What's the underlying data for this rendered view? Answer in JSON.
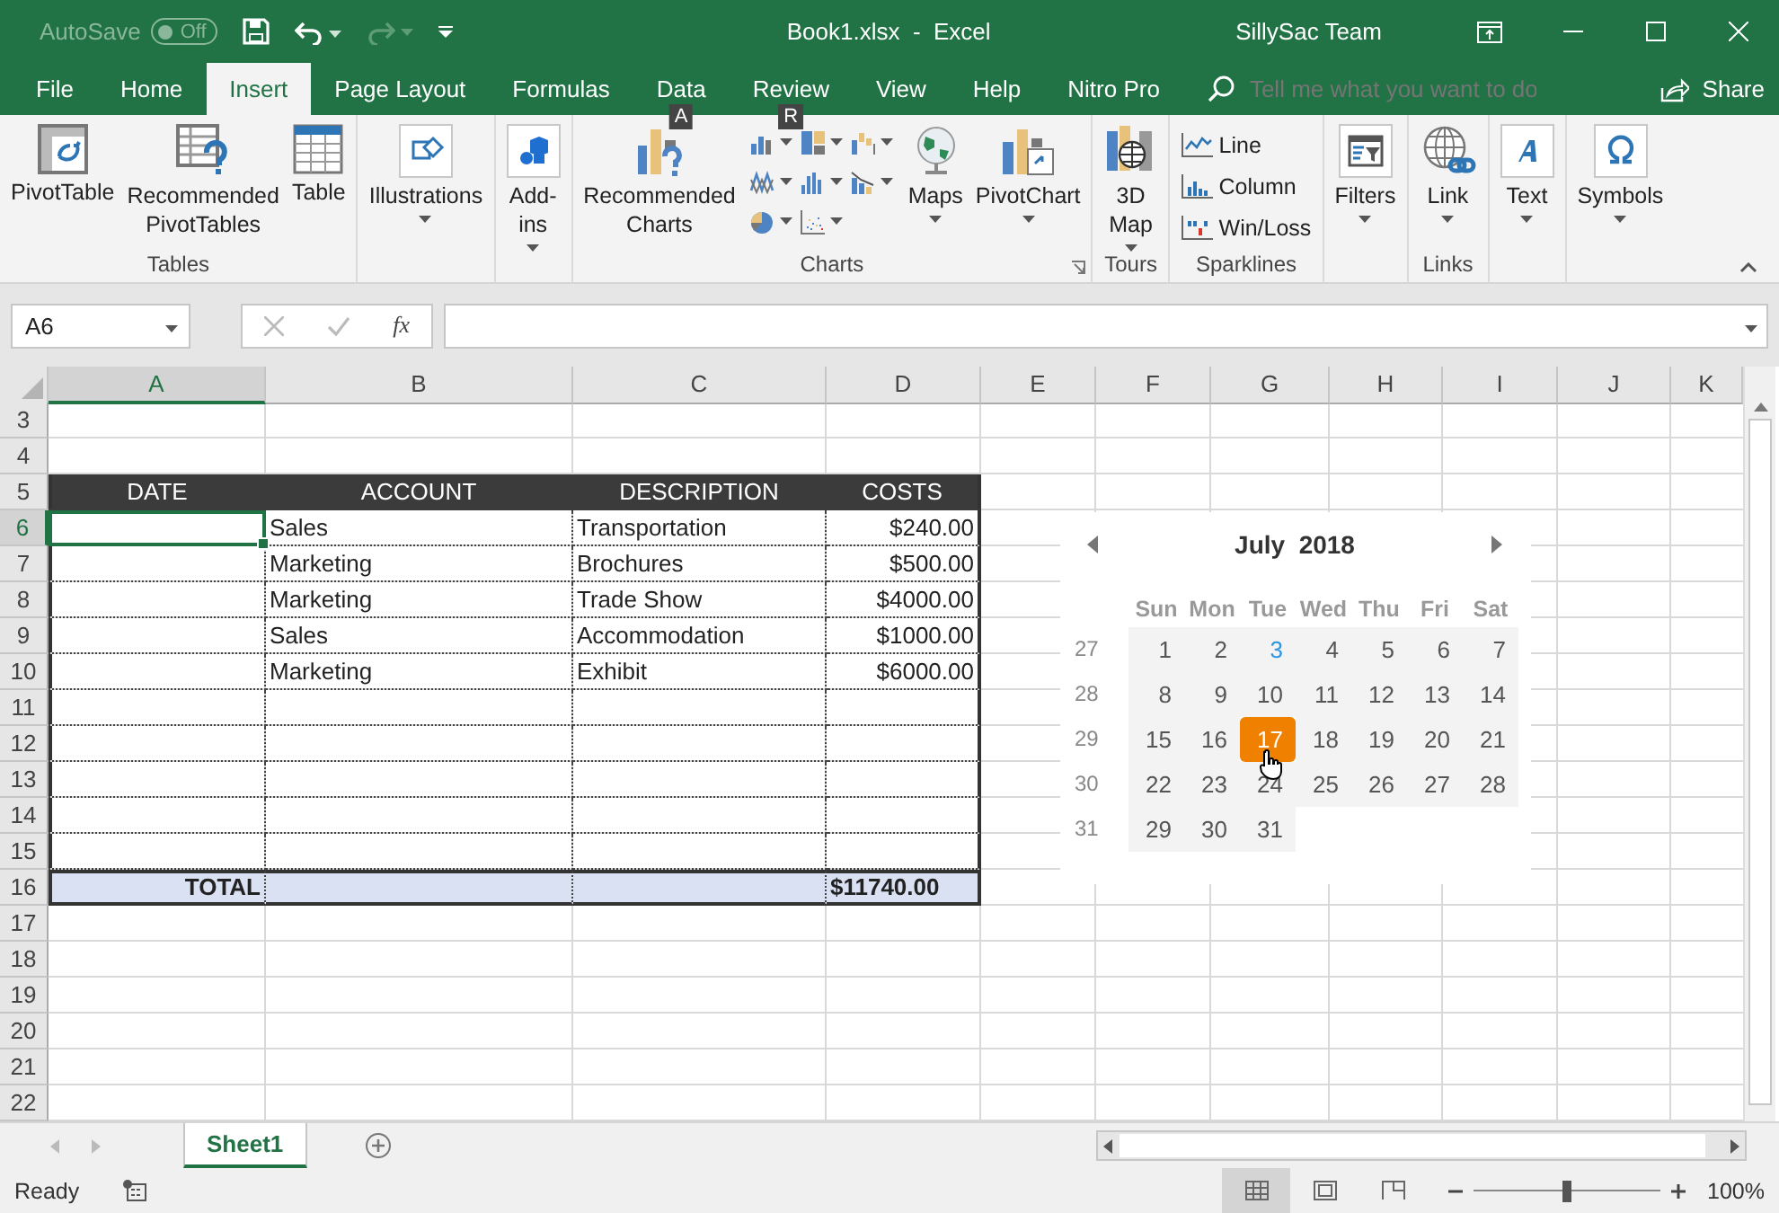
{
  "window": {
    "autosave_label": "AutoSave",
    "autosave_toggle": {
      "label": "Off",
      "on": false
    },
    "title": "Book1.xlsx  -  Excel",
    "user": "SillySac Team"
  },
  "tabs": [
    {
      "label": "File",
      "selected": false
    },
    {
      "label": "Home",
      "selected": false
    },
    {
      "label": "Insert",
      "selected": true
    },
    {
      "label": "Page Layout",
      "selected": false
    },
    {
      "label": "Formulas",
      "selected": false
    },
    {
      "label": "Data",
      "selected": false,
      "keytip": "A"
    },
    {
      "label": "Review",
      "selected": false,
      "keytip": "R"
    },
    {
      "label": "View",
      "selected": false
    },
    {
      "label": "Help",
      "selected": false
    },
    {
      "label": "Nitro Pro",
      "selected": false
    }
  ],
  "search": {
    "placeholder": "Tell me what you want to do"
  },
  "share": "Share",
  "ribbon": {
    "groups": [
      {
        "label": "Tables",
        "items": [
          {
            "label": "PivotTable",
            "kind": "button"
          },
          {
            "label": "Recommended PivotTables",
            "kind": "button"
          },
          {
            "label": "Table",
            "kind": "button"
          }
        ]
      },
      {
        "items": [
          {
            "label": "Illustrations",
            "kind": "menu"
          }
        ]
      },
      {
        "items": [
          {
            "label": "Add-ins",
            "kind": "menu"
          }
        ]
      },
      {
        "label": "Charts",
        "launcher": true,
        "items": [
          {
            "label": "Recommended Charts",
            "kind": "button"
          },
          {
            "kind": "gallery"
          },
          {
            "label": "Maps",
            "kind": "menu"
          },
          {
            "label": "PivotChart",
            "kind": "menu"
          }
        ]
      },
      {
        "label": "Tours",
        "items": [
          {
            "label": "3D Map",
            "kind": "menu"
          }
        ]
      },
      {
        "label": "Sparklines",
        "items": [
          {
            "label": "Line",
            "kind": "small"
          },
          {
            "label": "Column",
            "kind": "small"
          },
          {
            "label": "Win/Loss",
            "kind": "small"
          }
        ]
      },
      {
        "items": [
          {
            "label": "Filters",
            "kind": "menu"
          }
        ]
      },
      {
        "label": "Links",
        "items": [
          {
            "label": "Link",
            "kind": "menu"
          }
        ]
      },
      {
        "items": [
          {
            "label": "Text",
            "kind": "menu"
          }
        ]
      },
      {
        "items": [
          {
            "label": "Symbols",
            "kind": "menu"
          }
        ]
      }
    ]
  },
  "formula_bar": {
    "name_box": "A6",
    "function_label": "fx"
  },
  "sheet": {
    "columns": [
      {
        "label": "A",
        "selected": true
      },
      {
        "label": "B",
        "selected": false
      },
      {
        "label": "C",
        "selected": false
      },
      {
        "label": "D",
        "selected": false
      },
      {
        "label": "E",
        "selected": false
      },
      {
        "label": "F",
        "selected": false
      },
      {
        "label": "G",
        "selected": false
      },
      {
        "label": "H",
        "selected": false
      },
      {
        "label": "I",
        "selected": false
      },
      {
        "label": "J",
        "selected": false
      },
      {
        "label": "K",
        "selected": false
      }
    ],
    "rows": [
      {
        "number": "3",
        "kind": "blank",
        "selected": false
      },
      {
        "number": "4",
        "kind": "blank",
        "selected": false
      },
      {
        "number": "5",
        "kind": "header",
        "selected": false,
        "cells": [
          "DATE",
          "ACCOUNT",
          "DESCRIPTION",
          "COSTS"
        ]
      },
      {
        "number": "6",
        "kind": "data",
        "selected": true,
        "account": "Sales",
        "description": "Transportation",
        "cost": "$240.00"
      },
      {
        "number": "7",
        "kind": "data",
        "selected": false,
        "account": "Marketing",
        "description": "Brochures",
        "cost": "$500.00"
      },
      {
        "number": "8",
        "kind": "data",
        "selected": false,
        "account": "Marketing",
        "description": "Trade Show",
        "cost": "$4000.00"
      },
      {
        "number": "9",
        "kind": "data",
        "selected": false,
        "account": "Sales",
        "description": "Accommodation",
        "cost": "$1000.00"
      },
      {
        "number": "10",
        "kind": "data",
        "selected": false,
        "account": "Marketing",
        "description": "Exhibit",
        "cost": "$6000.00"
      },
      {
        "number": "11",
        "kind": "data",
        "selected": false
      },
      {
        "number": "12",
        "kind": "data",
        "selected": false
      },
      {
        "number": "13",
        "kind": "data",
        "selected": false
      },
      {
        "number": "14",
        "kind": "data",
        "selected": false
      },
      {
        "number": "15",
        "kind": "data",
        "selected": false
      },
      {
        "number": "16",
        "kind": "total",
        "selected": false,
        "label": "TOTAL",
        "cost": "$11740.00"
      },
      {
        "number": "17",
        "kind": "blank",
        "selected": false
      },
      {
        "number": "18",
        "kind": "blank",
        "selected": false
      },
      {
        "number": "19",
        "kind": "blank",
        "selected": false
      },
      {
        "number": "20",
        "kind": "blank",
        "selected": false
      },
      {
        "number": "21",
        "kind": "blank",
        "selected": false
      },
      {
        "number": "22",
        "kind": "blank",
        "selected": false
      }
    ]
  },
  "calendar": {
    "title": "July  2018",
    "weekdays": [
      "Sun",
      "Mon",
      "Tue",
      "Wed",
      "Thu",
      "Fri",
      "Sat"
    ],
    "weeks": [
      {
        "number": "27",
        "days": [
          {
            "label": "1",
            "today": false,
            "selected": false
          },
          {
            "label": "2",
            "today": false,
            "selected": false
          },
          {
            "label": "3",
            "today": true,
            "selected": false
          },
          {
            "label": "4",
            "today": false,
            "selected": false
          },
          {
            "label": "5",
            "today": false,
            "selected": false
          },
          {
            "label": "6",
            "today": false,
            "selected": false
          },
          {
            "label": "7",
            "today": false,
            "selected": false
          }
        ]
      },
      {
        "number": "28",
        "days": [
          {
            "label": "8",
            "today": false,
            "selected": false
          },
          {
            "label": "9",
            "today": false,
            "selected": false
          },
          {
            "label": "10",
            "today": false,
            "selected": false
          },
          {
            "label": "11",
            "today": false,
            "selected": false
          },
          {
            "label": "12",
            "today": false,
            "selected": false
          },
          {
            "label": "13",
            "today": false,
            "selected": false
          },
          {
            "label": "14",
            "today": false,
            "selected": false
          }
        ]
      },
      {
        "number": "29",
        "days": [
          {
            "label": "15",
            "today": false,
            "selected": false
          },
          {
            "label": "16",
            "today": false,
            "selected": false
          },
          {
            "label": "17",
            "today": false,
            "selected": true
          },
          {
            "label": "18",
            "today": false,
            "selected": false
          },
          {
            "label": "19",
            "today": false,
            "selected": false
          },
          {
            "label": "20",
            "today": false,
            "selected": false
          },
          {
            "label": "21",
            "today": false,
            "selected": false
          }
        ]
      },
      {
        "number": "30",
        "days": [
          {
            "label": "22",
            "today": false,
            "selected": false
          },
          {
            "label": "23",
            "today": false,
            "selected": false
          },
          {
            "label": "24",
            "today": false,
            "selected": false
          },
          {
            "label": "25",
            "today": false,
            "selected": false
          },
          {
            "label": "26",
            "today": false,
            "selected": false
          },
          {
            "label": "27",
            "today": false,
            "selected": false
          },
          {
            "label": "28",
            "today": false,
            "selected": false
          }
        ]
      },
      {
        "number": "31",
        "days": [
          {
            "label": "29",
            "today": false,
            "selected": false
          },
          {
            "label": "30",
            "today": false,
            "selected": false
          },
          {
            "label": "31",
            "today": false,
            "selected": false
          }
        ]
      }
    ]
  },
  "sheet_tabs": [
    {
      "label": "Sheet1",
      "selected": true
    }
  ],
  "status_bar": {
    "status": "Ready",
    "views": [
      {
        "selected": true
      },
      {
        "selected": false
      },
      {
        "selected": false
      }
    ],
    "zoom_slider": {
      "level": 0.5
    },
    "zoom": "100%"
  }
}
